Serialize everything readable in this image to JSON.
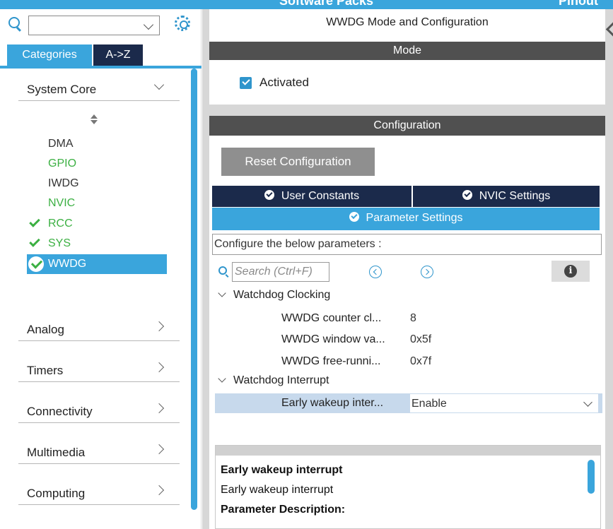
{
  "header": {
    "title": "Software Packs",
    "right_text": "Pinout"
  },
  "left": {
    "search": {
      "placeholder": ""
    },
    "tabs": {
      "categories": "Categories",
      "az": "A->Z"
    },
    "categories": [
      {
        "label": "System Core",
        "expanded": true
      },
      {
        "label": "Analog",
        "expanded": false
      },
      {
        "label": "Timers",
        "expanded": false
      },
      {
        "label": "Connectivity",
        "expanded": false
      },
      {
        "label": "Multimedia",
        "expanded": false
      },
      {
        "label": "Computing",
        "expanded": false
      }
    ],
    "peripherals": [
      {
        "label": "DMA",
        "state": "normal"
      },
      {
        "label": "GPIO",
        "state": "configured"
      },
      {
        "label": "IWDG",
        "state": "normal"
      },
      {
        "label": "NVIC",
        "state": "configured"
      },
      {
        "label": "RCC",
        "state": "checked"
      },
      {
        "label": "SYS",
        "state": "checked"
      },
      {
        "label": "WWDG",
        "state": "selected"
      }
    ]
  },
  "main": {
    "title": "WWDG Mode and Configuration",
    "mode_header": "Mode",
    "activated_label": "Activated",
    "activated": true,
    "config_header": "Configuration",
    "reset_button": "Reset Configuration",
    "tabs": {
      "user_constants": "User Constants",
      "nvic_settings": "NVIC Settings",
      "parameter_settings": "Parameter Settings"
    },
    "configure_text": "Configure the below parameters :",
    "param_search_placeholder": "Search (Ctrl+F)",
    "groups": [
      {
        "label": "Watchdog Clocking",
        "params": [
          {
            "name": "WWDG counter cl...",
            "value": "8"
          },
          {
            "name": "WWDG window va...",
            "value": "0x5f"
          },
          {
            "name": "WWDG free-runni...",
            "value": "0x7f"
          }
        ]
      },
      {
        "label": "Watchdog Interrupt",
        "params": [
          {
            "name": "Early wakeup inter...",
            "value": "Enable"
          }
        ]
      }
    ],
    "description": {
      "title": "Early wakeup interrupt",
      "text": "Early wakeup interrupt",
      "section": "Parameter Description:"
    }
  },
  "colors": {
    "accent": "#3aa5dc",
    "dark_tab": "#1b2a4b",
    "header_bar": "#505050",
    "configured_green": "#3cb043"
  },
  "icons": [
    "search-icon",
    "gear-icon",
    "chevron-down-icon",
    "chevron-right-icon",
    "sort-icon",
    "check-icon",
    "info-icon",
    "prev-icon",
    "next-icon"
  ]
}
